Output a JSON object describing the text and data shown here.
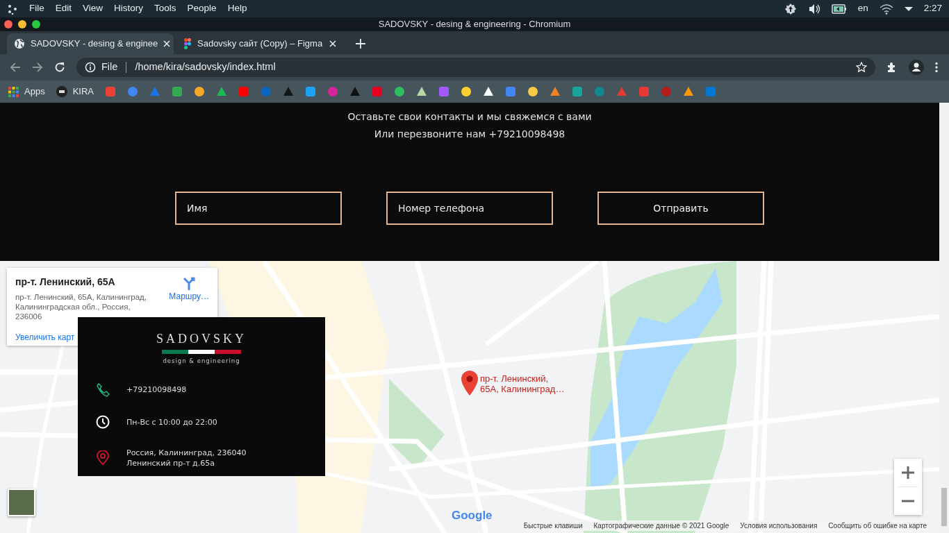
{
  "os_bar": {
    "menu": [
      "File",
      "Edit",
      "View",
      "History",
      "Tools",
      "People",
      "Help"
    ],
    "keyboard_layout": "en",
    "clock": "2:27"
  },
  "window": {
    "title": "SADOVSKY - desing & engineering - Chromium"
  },
  "tabs": [
    {
      "label": "SADOVSKY - desing & enginee",
      "selected": true
    },
    {
      "label": "Sadovsky сайт (Copy) – Figma",
      "selected": false
    }
  ],
  "address_bar": {
    "scheme": "File",
    "url": "/home/kira/sadovsky/index.html"
  },
  "bookmarks": [
    {
      "label": "Apps"
    },
    {
      "label": "KIRA"
    }
  ],
  "contact_section": {
    "lines": [
      "Оставьте свои контакты и мы свяжемся с вами",
      "Или перезвоните нам +79210098498"
    ],
    "fields": [
      {
        "placeholder": "Имя"
      },
      {
        "placeholder": "Номер телефона"
      }
    ],
    "submit": "Отправить"
  },
  "map": {
    "place_card": {
      "title": "пр-т. Ленинский, 65А",
      "address_lines": [
        "пр-т. Ленинский, 65А, Калининград,",
        "Калининградская обл., Россия,",
        "236006"
      ],
      "directions": "Маршру…",
      "enlarge": "Увеличить карт"
    },
    "marker_label": [
      "пр-т. Ленинский,",
      "65А, Калининград…"
    ],
    "logo": "Google",
    "footer": [
      "Быстрые клавиши",
      "Картографические данные © 2021 Google",
      "Условия использования",
      "Сообщить об ошибке на карте"
    ]
  },
  "info_card": {
    "brand": "SADOVSKY",
    "tagline": "design & engineering",
    "items": [
      {
        "kind": "phone",
        "lines": [
          "+79210098498"
        ]
      },
      {
        "kind": "hours",
        "lines": [
          "Пн-Вс с 10:00 до 22:00"
        ]
      },
      {
        "kind": "address",
        "lines": [
          "Россия, Калининград, 236040",
          "Ленинский пр-т д.65а"
        ]
      }
    ]
  }
}
